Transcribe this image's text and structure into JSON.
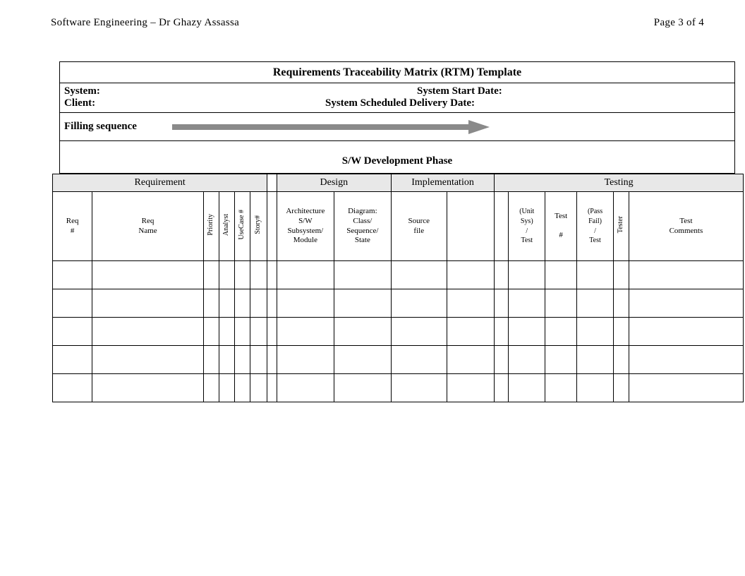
{
  "header": {
    "left": "Software  Engineering – Dr Ghazy  Assassa",
    "right": "Page 3 of 4"
  },
  "title": "Requirements Traceability Matrix (RTM) Template",
  "meta": {
    "system_label": "System:",
    "client_label": "Client:",
    "start_label": "System Start Date:",
    "delivery_label": "System Scheduled Delivery Date:"
  },
  "filling_label": "Filling sequence",
  "phase_label": "S/W Development Phase",
  "groups": {
    "requirement": "Requirement",
    "design": "Design",
    "implementation": "Implementation",
    "testing": "Testing"
  },
  "cols": {
    "req_no": "Req\n#",
    "req_name": "Req\nName",
    "priority": "Priority",
    "analyst": "Analyst",
    "usecase": "UseCase #",
    "story": "Story#",
    "arch": "Architecture\nS/W\nSubsystem/\nModule",
    "diagram": "Diagram:\nClass/\nSequence/\nState",
    "source": "Source\nfile",
    "test_type": "(Unit\nSys)\n/\nTest",
    "test_no": "Test\n\n#",
    "test_result": "(Pass\nFail)\n/\nTest",
    "tester": "Tester",
    "test_comments": "Test\nComments"
  },
  "rows": 5
}
